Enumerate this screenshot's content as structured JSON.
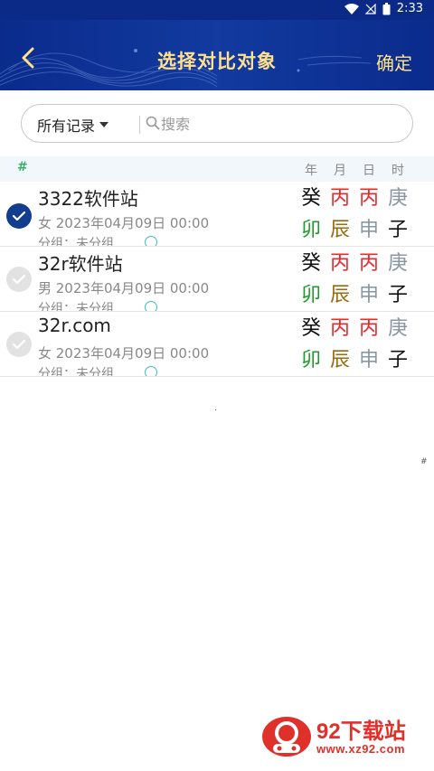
{
  "status_bar": {
    "time": "2:33"
  },
  "header": {
    "title": "选择对比对象",
    "confirm_label": "确定"
  },
  "search": {
    "filter_label": "所有记录",
    "placeholder": "搜索"
  },
  "columns": {
    "hash": "#",
    "year": "年",
    "month": "月",
    "day": "日",
    "hour": "时"
  },
  "colors": {
    "red": "#e52b2b",
    "gray": "#8a97a6",
    "black": "#111111",
    "green": "#1e9a2a",
    "brown": "#9a6a10",
    "checked": "#133d8e"
  },
  "records": [
    {
      "checked": true,
      "name": "3322软件站",
      "info": "女 2023年04月09日 00:00",
      "group": "分组：未分组",
      "top": [
        "癸",
        "丙",
        "丙",
        "庚"
      ],
      "bottom": [
        "卯",
        "辰",
        "申",
        "子"
      ]
    },
    {
      "checked": false,
      "name": "32r软件站",
      "info": "男 2023年04月09日 00:00",
      "group": "分组：未分组",
      "top": [
        "癸",
        "丙",
        "丙",
        "庚"
      ],
      "bottom": [
        "卯",
        "辰",
        "申",
        "子"
      ]
    },
    {
      "checked": false,
      "name": "32r.com",
      "info": "女 2023年04月09日 00:00",
      "group": "分组：未分组",
      "top": [
        "癸",
        "丙",
        "丙",
        "庚"
      ],
      "bottom": [
        "卯",
        "辰",
        "申",
        "子"
      ]
    }
  ],
  "stray_mark": "#",
  "watermark": {
    "title": "92下载站",
    "url": "www.xz92.com"
  }
}
